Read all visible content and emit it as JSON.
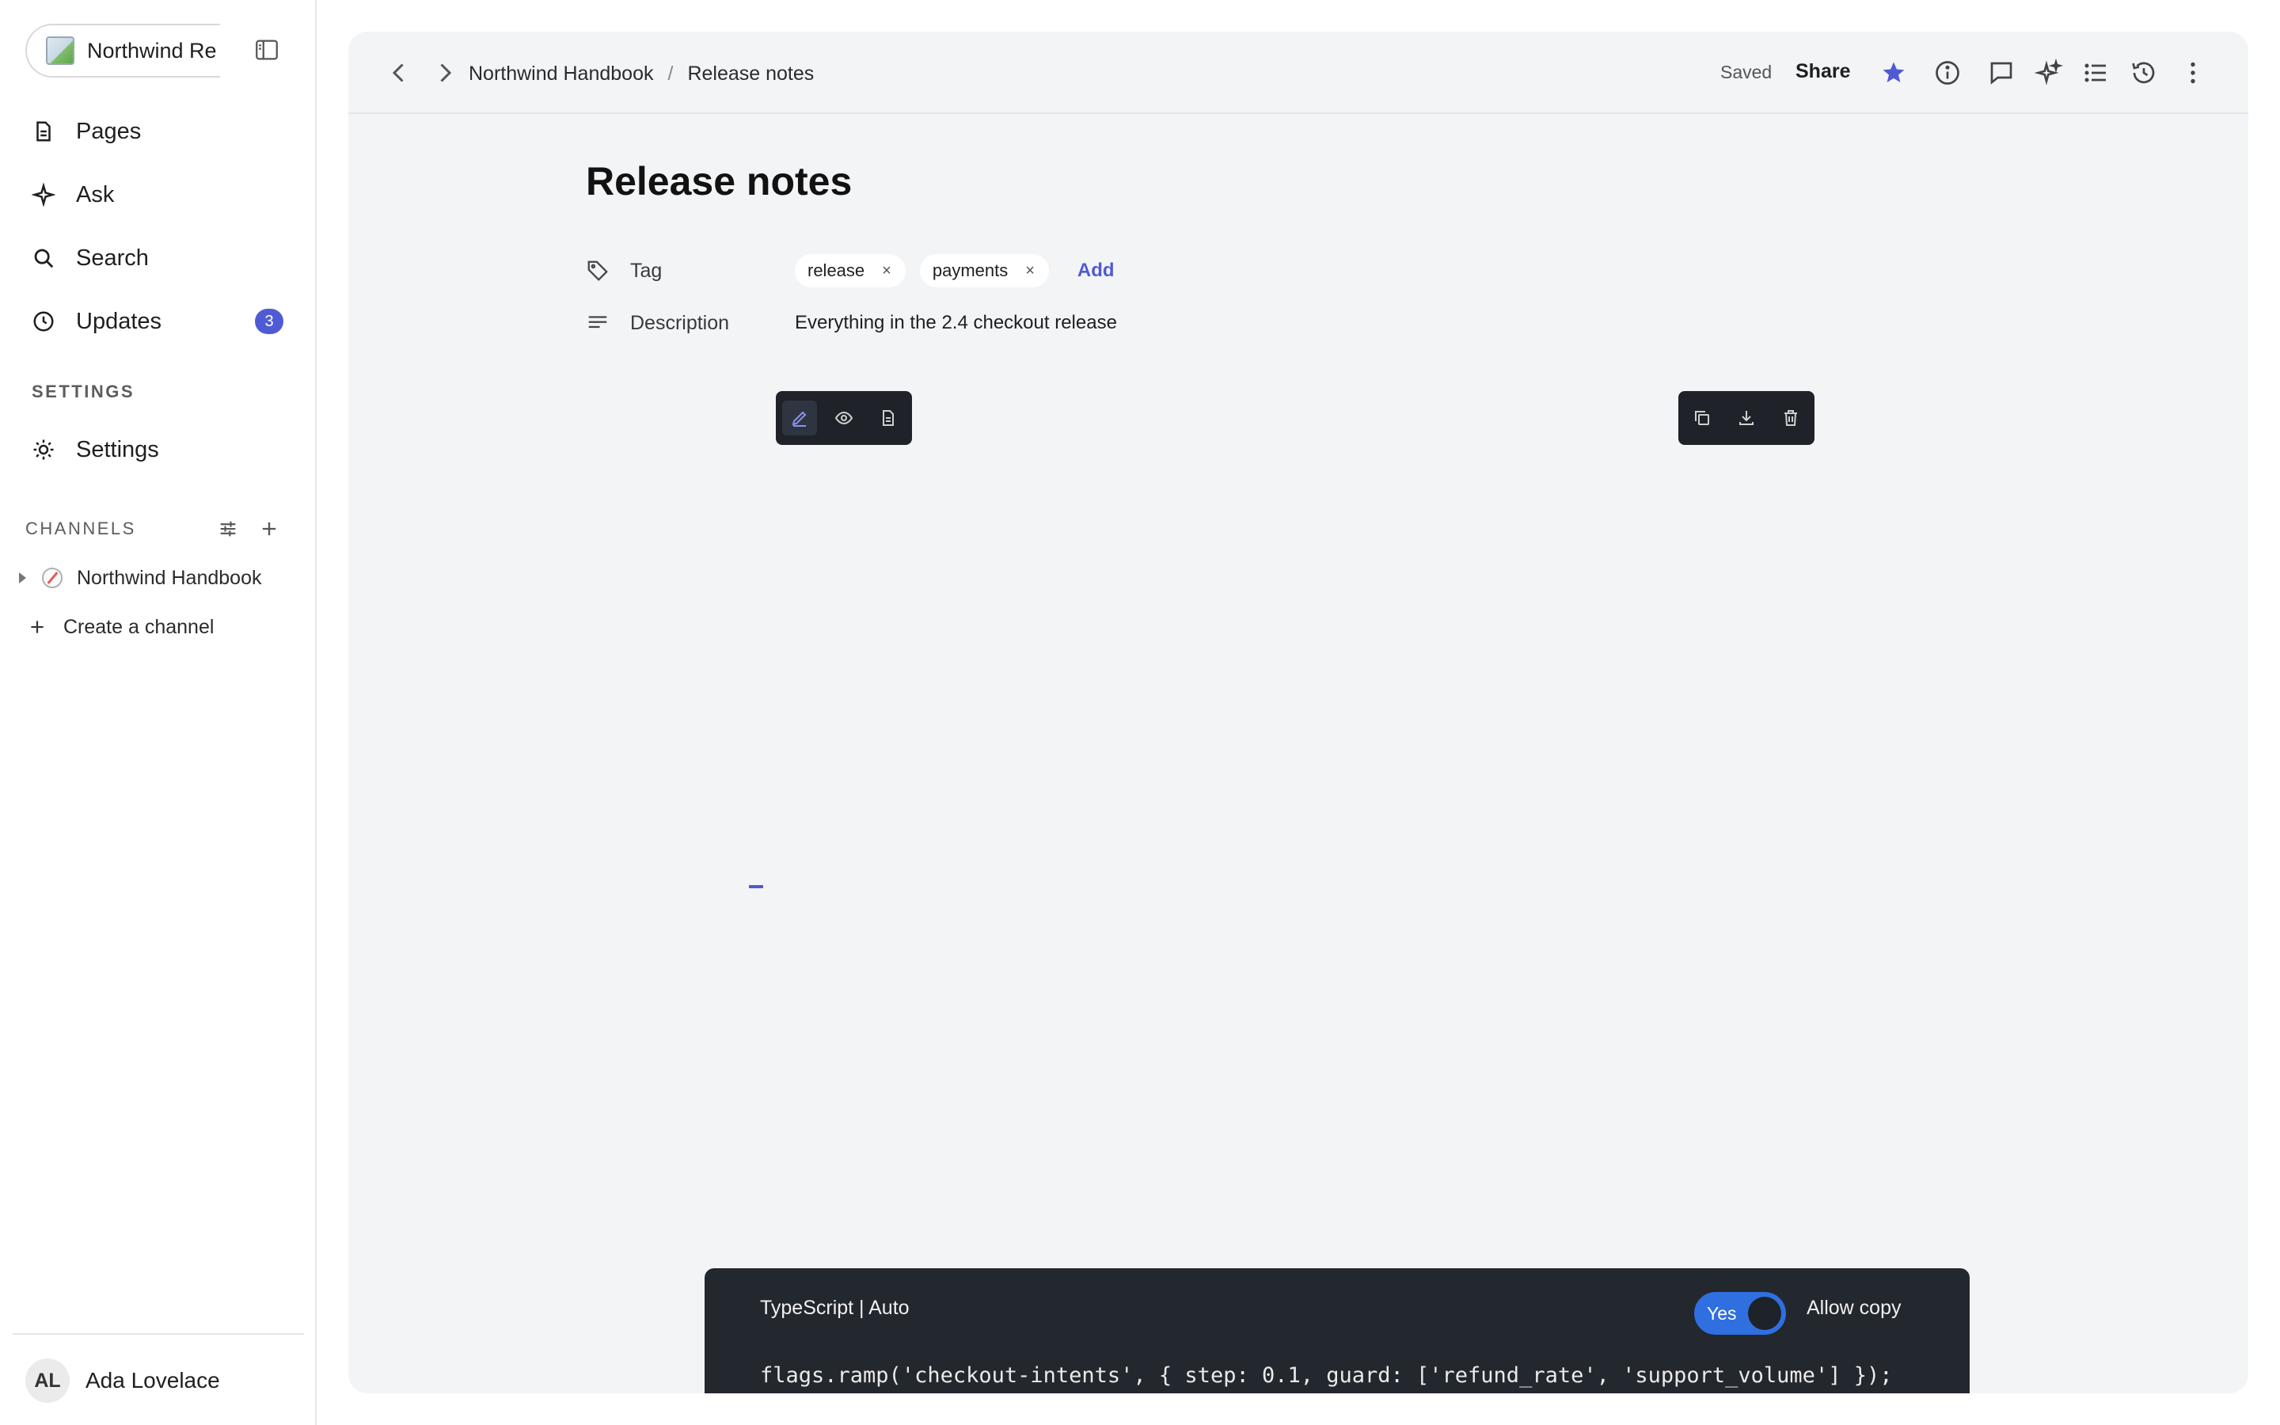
{
  "sidebar": {
    "workspace_name": "Northwind Re",
    "nav": [
      {
        "label": "Pages",
        "icon": "page-icon"
      },
      {
        "label": "Ask",
        "icon": "sparkle-icon"
      },
      {
        "label": "Search",
        "icon": "search-icon"
      },
      {
        "label": "Updates",
        "icon": "clock-icon",
        "badge": "3"
      }
    ],
    "settings_section": "SETTINGS",
    "settings_item": "Settings",
    "channels_section": "CHANNELS",
    "channels": [
      {
        "label": "Northwind Handbook",
        "icon": "compass-icon"
      }
    ],
    "create_channel": "Create a channel",
    "user": {
      "initials": "AL",
      "name": "Ada Lovelace"
    }
  },
  "topbar": {
    "breadcrumb": [
      "Northwind Handbook",
      "Release notes"
    ],
    "breadcrumb_separator": "/",
    "status": "Saved",
    "share_label": "Share",
    "accent": "#4f5bd5"
  },
  "doc": {
    "title": "Release notes",
    "tag_label": "Tag",
    "tags": [
      "release",
      "payments"
    ],
    "tag_remove": "×",
    "add_label": "Add",
    "description_label": "Description",
    "description_value": "Everything in the 2.4 checkout release"
  },
  "code_block": {
    "language": "TypeScript | Auto",
    "toggle_label": "Yes",
    "toggle_on": true,
    "allow_copy_label": "Allow copy",
    "code": "flags.ramp('checkout-intents', { step: 0.1, guard: ['refund_rate', 'support_volume'] });"
  }
}
